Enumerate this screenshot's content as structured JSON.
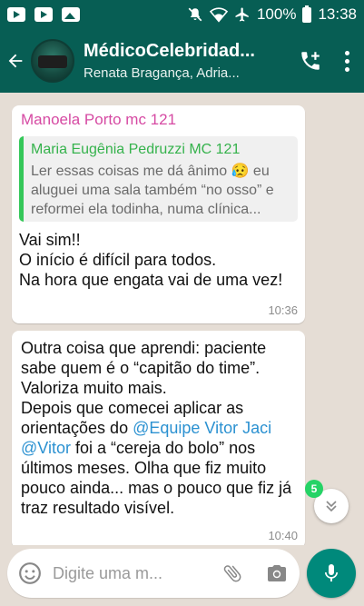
{
  "status_bar": {
    "battery": "100%",
    "time": "13:38",
    "icons": [
      "youtube-icon",
      "youtube-icon",
      "image-icon",
      "mute-icon",
      "wifi-icon",
      "airplane-icon",
      "battery-icon"
    ]
  },
  "header": {
    "title": "MédicoCelebridad...",
    "subtitle": "Renata Bragança, Adria..."
  },
  "messages": [
    {
      "sender": "Manoela Porto mc 121",
      "quote": {
        "author": "Maria Eugênia Pedruzzi MC 121",
        "text": "Ler essas coisas me dá ânimo 😥 eu aluguei uma sala também “no osso” e reformei ela todinha, numa clínica..."
      },
      "text": "Vai sim!!\nO início é difícil para todos.\nNa hora que engata vai de uma vez!",
      "time": "10:36"
    },
    {
      "text_before": "Outra coisa que aprendi: paciente sabe quem é o “capitão do time”. Valoriza muito mais.\nDepois que comecei aplicar as orientações do ",
      "mention1": "@Equipe Vitor Jaci",
      "text_mid": " ",
      "mention2": "@Vitor",
      "text_after": " foi a “cereja do bolo” nos últimos meses. Olha que fiz muito pouco ainda... mas o pouco que fiz já traz resultado visível.",
      "time": "10:40"
    }
  ],
  "unread_count": "5",
  "input": {
    "placeholder": "Digite uma m..."
  },
  "colors": {
    "header": "#075e54",
    "chat_bg": "#e5ddd5",
    "sender": "#d64aa3",
    "quote_accent": "#35c759",
    "mention": "#2b91d1",
    "mic_button": "#00897b"
  }
}
